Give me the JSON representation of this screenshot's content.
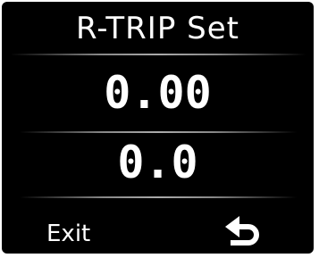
{
  "screen": {
    "title": "R-TRIP Set",
    "values": [
      "0.00",
      "0.0"
    ],
    "exit_label": "Exit",
    "back_icon": "return-arrow-icon"
  }
}
